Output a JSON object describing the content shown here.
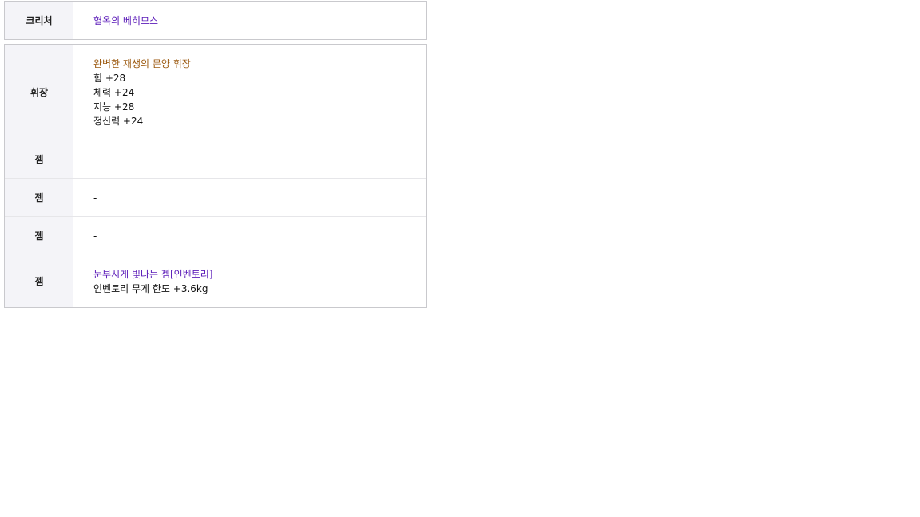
{
  "creature": {
    "label": "크리처",
    "name": "혈옥의 베히모스",
    "name_color": "#5a1ab8"
  },
  "emblem": {
    "label": "휘장",
    "name": "완벽한 재생의 문양 휘장",
    "name_color": "#9c5a10",
    "stats": [
      "힘 +28",
      "체력 +24",
      "지능 +28",
      "정신력 +24"
    ]
  },
  "gems": [
    {
      "label": "젬",
      "value": "-"
    },
    {
      "label": "젬",
      "value": "-"
    },
    {
      "label": "젬",
      "value": "-"
    },
    {
      "label": "젬",
      "name": "눈부시게 빛나는 젬[인벤토리]",
      "name_color": "#5a1ab8",
      "effect": "인벤토리 무게 한도 +3.6kg"
    }
  ],
  "colors": {
    "label_background": "#f4f4f8",
    "border": "#c9c9cd",
    "row_divider": "#e6e6e9"
  }
}
